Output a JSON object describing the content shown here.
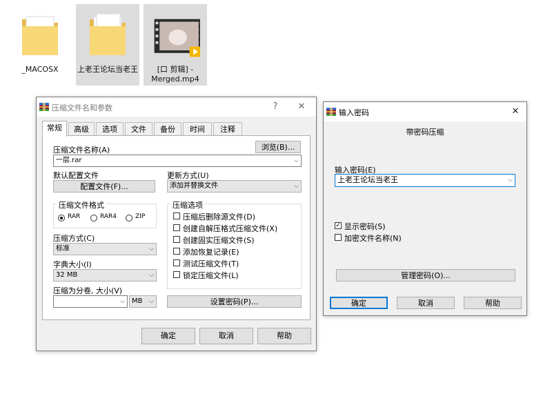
{
  "desktop": {
    "files": [
      {
        "label": "_MACOSX",
        "icon": "folder-icon"
      },
      {
        "label": "上老王论坛当老王",
        "icon": "folder-icon"
      },
      {
        "label_line1": "[口 剪辑] -",
        "label_line2": "Merged.mp4",
        "icon": "video-file-icon"
      }
    ]
  },
  "archive_dialog": {
    "title": "压缩文件名和参数",
    "help_glyph": "?",
    "close_glyph": "✕",
    "tabs": [
      "常规",
      "高级",
      "选项",
      "文件",
      "备份",
      "时间",
      "注释"
    ],
    "archive_name_label": "压缩文件名称(A)",
    "browse_button": "浏览(B)...",
    "archive_name_value": "一层.rar",
    "default_profile_label": "默认配置文件",
    "profiles_button": "配置文件(F)...",
    "update_mode_label": "更新方式(U)",
    "update_mode_value": "添加并替换文件",
    "format_group_title": "压缩文件格式",
    "formats": [
      "RAR",
      "RAR4",
      "ZIP"
    ],
    "selected_format": "RAR",
    "method_label": "压缩方式(C)",
    "method_value": "标准",
    "dict_label": "字典大小(I)",
    "dict_value": "32 MB",
    "split_label": "压缩为分卷, 大小(V)",
    "split_value": "",
    "split_unit": "MB",
    "options_group_title": "压缩选项",
    "options": [
      {
        "label": "压缩后删除源文件(D)",
        "checked": false
      },
      {
        "label": "创建自解压格式压缩文件(X)",
        "checked": false
      },
      {
        "label": "创建固实压缩文件(S)",
        "checked": false
      },
      {
        "label": "添加恢复记录(E)",
        "checked": false
      },
      {
        "label": "测试压缩文件(T)",
        "checked": false
      },
      {
        "label": "锁定压缩文件(L)",
        "checked": false
      }
    ],
    "set_password_button": "设置密码(P)...",
    "ok_button": "确定",
    "cancel_button": "取消",
    "help_button": "帮助"
  },
  "password_dialog": {
    "title": "输入密码",
    "close_glyph": "✕",
    "subtitle": "带密码压缩",
    "password_label": "输入密码(E)",
    "password_value": "上老王论坛当老王",
    "show_password_label": "显示密码(S)",
    "show_password_checked": true,
    "encrypt_names_label": "加密文件名称(N)",
    "encrypt_names_checked": false,
    "manage_button": "管理密码(O)...",
    "ok_button": "确定",
    "cancel_button": "取消",
    "help_button": "帮助"
  },
  "colors": {
    "accent": "#0078d7",
    "dialog_bg": "#f0f0f0",
    "folder": "#f8d775"
  },
  "glyphs": {
    "dropdown": "⌵",
    "check": "✓",
    "play_badge": "▶"
  }
}
